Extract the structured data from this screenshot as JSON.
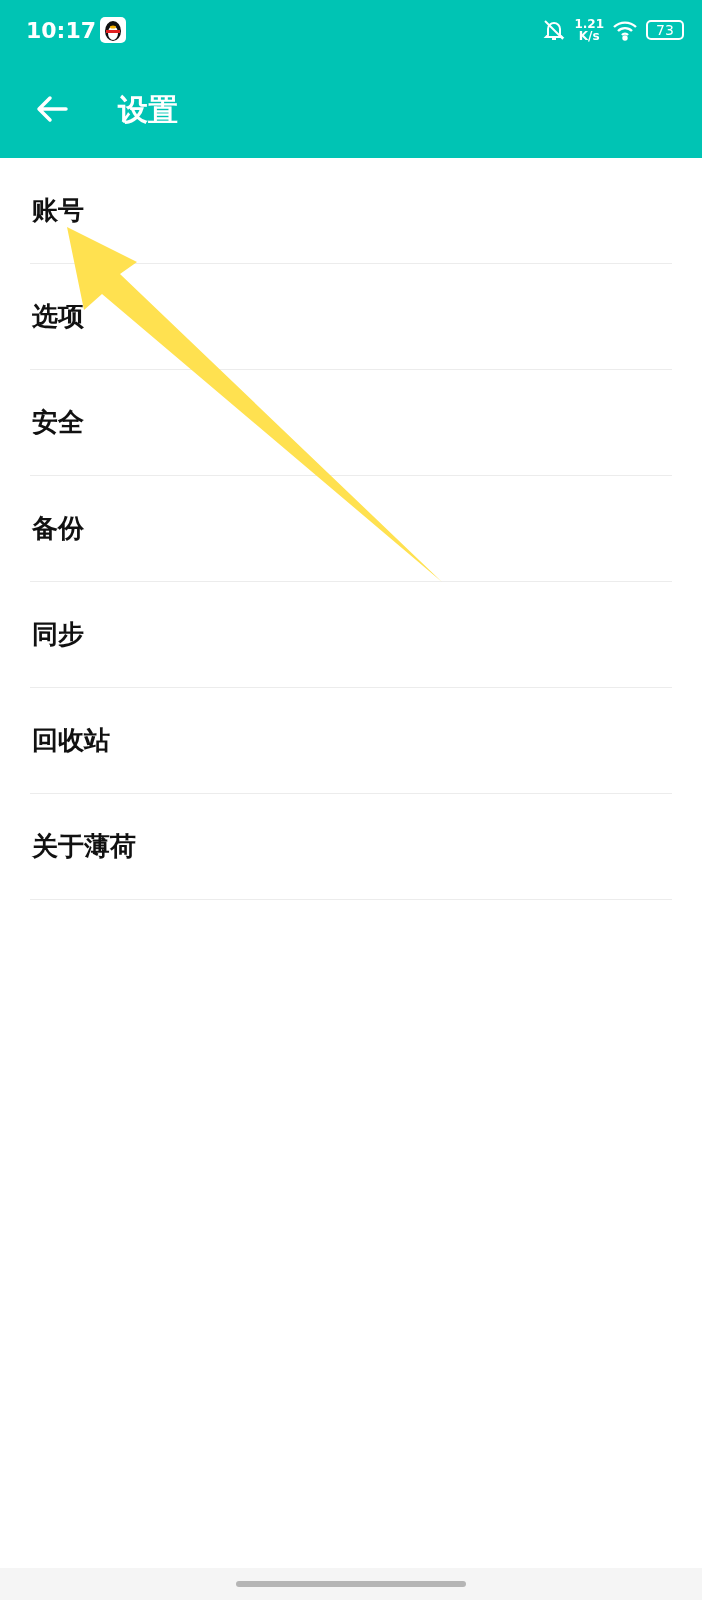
{
  "status_bar": {
    "time": "10:17",
    "net_speed_value": "1.21",
    "net_speed_unit": "K/s",
    "battery": "73"
  },
  "app_bar": {
    "title": "设置"
  },
  "settings_items": [
    {
      "label": "账号"
    },
    {
      "label": "选项"
    },
    {
      "label": "安全"
    },
    {
      "label": "备份"
    },
    {
      "label": "同步"
    },
    {
      "label": "回收站"
    },
    {
      "label": "关于薄荷"
    }
  ]
}
